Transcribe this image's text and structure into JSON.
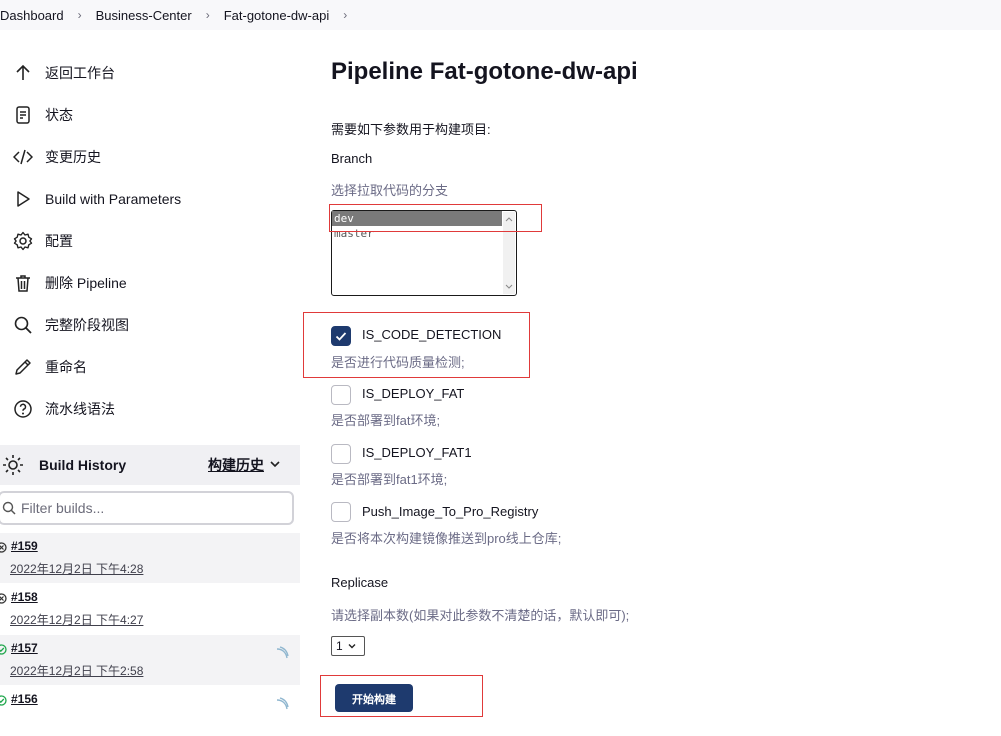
{
  "breadcrumb": {
    "items": [
      "Dashboard",
      "Business-Center",
      "Fat-gotone-dw-api"
    ],
    "separator": "›"
  },
  "sidebar": {
    "tasks": [
      {
        "label": "返回工作台",
        "icon": "arrow-up-icon"
      },
      {
        "label": "状态",
        "icon": "document-icon"
      },
      {
        "label": "变更历史",
        "icon": "code-icon"
      },
      {
        "label": "Build with Parameters",
        "icon": "play-icon"
      },
      {
        "label": "配置",
        "icon": "gear-icon"
      },
      {
        "label": "删除 Pipeline",
        "icon": "trash-icon"
      },
      {
        "label": "完整阶段视图",
        "icon": "search-icon"
      },
      {
        "label": "重命名",
        "icon": "pencil-icon"
      },
      {
        "label": "流水线语法",
        "icon": "help-icon"
      }
    ]
  },
  "build_history": {
    "title": "Build History",
    "trend_label": "构建历史",
    "filter_placeholder": "Filter builds...",
    "builds": [
      {
        "number": "#159",
        "time": "2022年12月2日 下午4:28",
        "status": "aborted"
      },
      {
        "number": "#158",
        "time": "2022年12月2日 下午4:27",
        "status": "aborted"
      },
      {
        "number": "#157",
        "time": "2022年12月2日 下午2:58",
        "status": "success"
      },
      {
        "number": "#156",
        "time": "",
        "status": "success"
      }
    ]
  },
  "main": {
    "title": "Pipeline Fat-gotone-dw-api",
    "intro": "需要如下参数用于构建项目:",
    "branch": {
      "label": "Branch",
      "description": "选择拉取代码的分支",
      "options": [
        "dev",
        "master"
      ],
      "selected": "dev"
    },
    "checkboxes": [
      {
        "label": "IS_CODE_DETECTION",
        "description": "是否进行代码质量检测;",
        "checked": true
      },
      {
        "label": "IS_DEPLOY_FAT",
        "description": "是否部署到fat环境;",
        "checked": false
      },
      {
        "label": "IS_DEPLOY_FAT1",
        "description": "是否部署到fat1环境;",
        "checked": false
      },
      {
        "label": "Push_Image_To_Pro_Registry",
        "description": "是否将本次构建镜像推送到pro线上仓库;",
        "checked": false
      }
    ],
    "replicase": {
      "label": "Replicase",
      "description": "请选择副本数(如果对此参数不清楚的话，默认即可);",
      "value": "1"
    },
    "build_button": "开始构建"
  },
  "colors": {
    "accent": "#1e3a6e",
    "highlight": "#e03a3a",
    "description_text": "#6b6b86",
    "success": "#1ea64b"
  }
}
